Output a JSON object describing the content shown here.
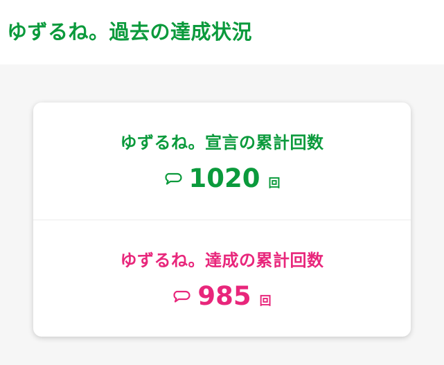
{
  "header": {
    "title": "ゆずるね。過去の達成状況"
  },
  "stats": [
    {
      "label": "ゆずるね。宣言の累計回数",
      "value": "1020",
      "unit": "回",
      "icon": "speech-bubble-icon",
      "color": "#0b9a3c"
    },
    {
      "label": "ゆずるね。達成の累計回数",
      "value": "985",
      "unit": "回",
      "icon": "speech-bubble-icon",
      "color": "#e8267b"
    }
  ]
}
